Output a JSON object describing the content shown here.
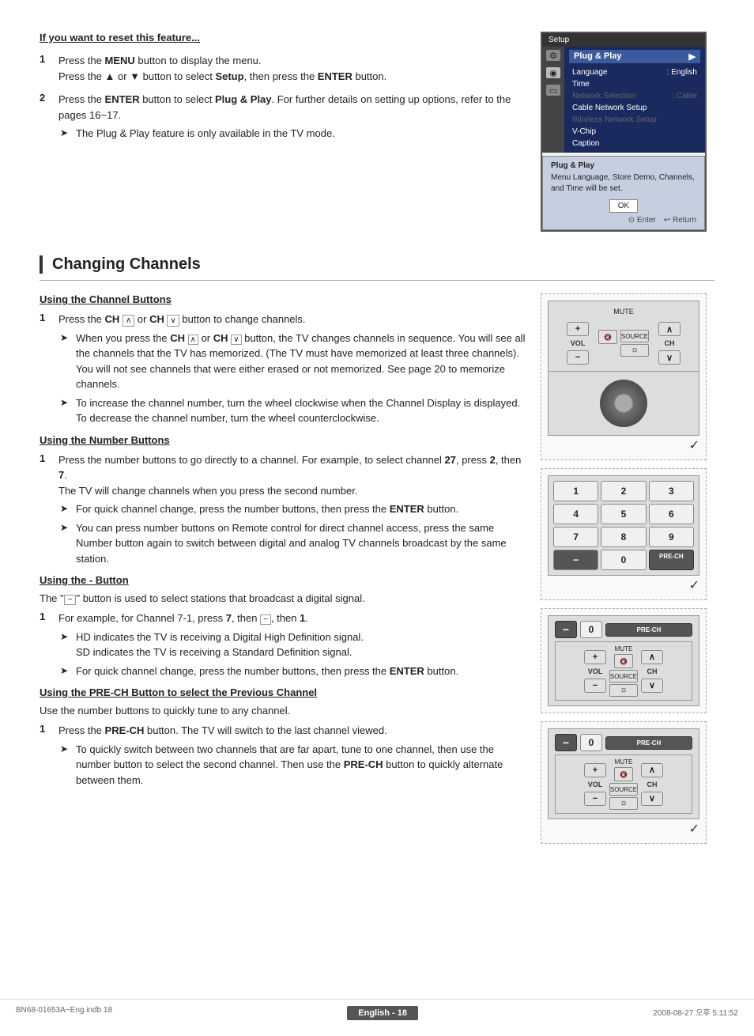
{
  "page": {
    "title": "Changing Channels",
    "footer": {
      "left": "BN68-01653A~Eng.indb   18",
      "center": "English - 18",
      "right": "2008-08-27   오후 5:11:52"
    }
  },
  "top_section": {
    "heading": "If you want to reset this feature...",
    "steps": [
      {
        "num": "1",
        "text": "Press the MENU button to display the menu.",
        "text2": "Press the ▲ or ▼ button to select Setup, then press the ENTER button."
      },
      {
        "num": "2",
        "text": "Press the ENTER button to select Plug & Play. For further details on setting up options, refer to the pages 16~17.",
        "arrow": "The Plug & Play feature is only available in the TV mode."
      }
    ]
  },
  "tv_menu": {
    "title": "Plug & Play",
    "items": [
      {
        "label": "Language",
        "value": ": English",
        "state": "normal"
      },
      {
        "label": "Time",
        "value": "",
        "state": "normal"
      },
      {
        "label": "Network Selection",
        "value": ": Cable",
        "state": "dimmed"
      },
      {
        "label": "Cable Network Setup",
        "value": "",
        "state": "normal"
      },
      {
        "label": "Wireless Network Setup",
        "value": "",
        "state": "dimmed"
      },
      {
        "label": "V-Chip",
        "value": "",
        "state": "normal"
      },
      {
        "label": "Caption",
        "value": "",
        "state": "normal"
      }
    ],
    "dialog": {
      "title": "Plug & Play",
      "text": "Menu Language, Store Demo, Channels, and Time will be set.",
      "ok_label": "OK",
      "enter_label": "⊙ Enter",
      "return_label": "↩ Return"
    }
  },
  "changing_channels": {
    "section_title": "Changing Channels",
    "subsections": [
      {
        "id": "channel_buttons",
        "heading": "Using the Channel Buttons",
        "steps": [
          {
            "num": "1",
            "text": "Press the CH ▲ or CH ▼ button to change channels.",
            "arrows": [
              "When you press the CH ▲ or CH ▼ button, the TV changes channels in sequence. You will see all the channels that the TV has memorized. (The TV must have memorized at least three channels). You will not see channels that were either erased or not memorized. See page 20 to memorize channels.",
              "To increase the channel number, turn the wheel clockwise when the Channel Display is displayed. To decrease the channel number, turn the wheel counterclockwise."
            ]
          }
        ]
      },
      {
        "id": "number_buttons",
        "heading": "Using the Number Buttons",
        "steps": [
          {
            "num": "1",
            "text": "Press the number buttons to go directly to a channel. For example, to select channel 27, press 2, then 7.",
            "text2": "The TV will change channels when you press the second number.",
            "arrows": [
              "For quick channel change, press the number buttons, then press the ENTER button.",
              "You can press number buttons on Remote control for direct channel access, press the same Number button again to switch between digital and analog TV channels broadcast by the same station."
            ]
          }
        ]
      },
      {
        "id": "dash_button",
        "heading": "Using the - Button",
        "intro": "The \"-\" button is used to select stations that broadcast a digital signal.",
        "steps": [
          {
            "num": "1",
            "text": "For example, for Channel 7-1, press 7, then -, then 1.",
            "arrows": [
              "HD indicates the TV is receiving a Digital High Definition signal. SD indicates the TV is receiving a Standard Definition signal.",
              "For quick channel change, press the number buttons, then press the ENTER button."
            ]
          }
        ]
      },
      {
        "id": "precht_button",
        "heading": "Using the PRE-CH Button to select the Previous Channel",
        "intro": "Use the number buttons to quickly tune to any channel.",
        "steps": [
          {
            "num": "1",
            "text": "Press the PRE-CH button. The TV will switch to the last channel viewed.",
            "arrows": [
              "To quickly switch between two channels that are far apart, tune to one channel, then use the number button to select the second channel. Then use the PRE-CH button to quickly alternate between them."
            ]
          }
        ]
      }
    ]
  },
  "remote1": {
    "vol_label": "VOL",
    "ch_label": "CH",
    "mute_label": "MUTE",
    "source_label": "SOURCE",
    "plus": "+",
    "minus": "−",
    "up_arrow": "∧",
    "down_arrow": "∨"
  },
  "remote2": {
    "buttons": [
      "1",
      "2",
      "3",
      "4",
      "5",
      "6",
      "7",
      "8",
      "9",
      "−",
      "0",
      "PRE-CH"
    ]
  },
  "remote3": {
    "top_row": [
      "−",
      "0",
      "PRE-CH"
    ],
    "has_vol_ch": true
  }
}
